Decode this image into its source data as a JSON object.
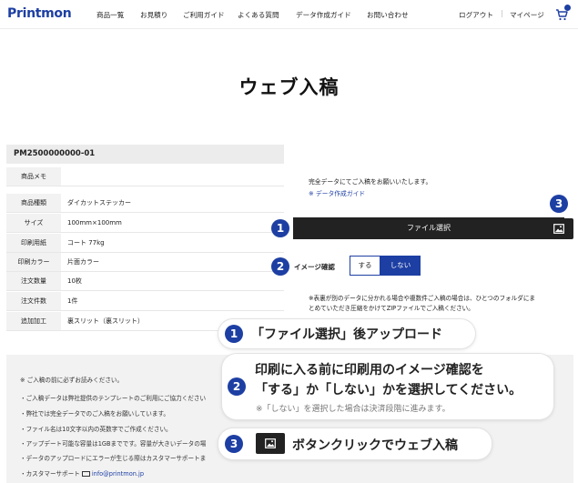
{
  "header": {
    "logo": "Printmon",
    "nav": [
      "商品一覧",
      "お見積り",
      "ご利用ガイド",
      "よくある質問",
      "データ作成ガイド",
      "お問い合わせ"
    ],
    "logout": "ログアウト",
    "separator": "|",
    "mypage": "マイページ",
    "cart_icon": "cart-icon"
  },
  "page": {
    "title": "ウェブ入稿"
  },
  "order": {
    "id": "PM2500000000-01",
    "rows": [
      {
        "label": "商品メモ",
        "value": ""
      },
      {
        "label": "商品種類",
        "value": "ダイカットステッカー"
      },
      {
        "label": "サイズ",
        "value": "100mm×100mm"
      },
      {
        "label": "印刷用紙",
        "value": "コート 77kg"
      },
      {
        "label": "印刷カラー",
        "value": "片面カラー"
      },
      {
        "label": "注文数量",
        "value": "10枚"
      },
      {
        "label": "注文件数",
        "value": "1件"
      },
      {
        "label": "追加加工",
        "value": "裏スリット（裏スリット）"
      }
    ]
  },
  "upload": {
    "intro": "完全データにてご入稿をお願いいたします。",
    "guide_link": "※ データ作成ガイド",
    "file_button": "ファイル選択",
    "image_button_icon": "image-icon",
    "image_confirm_label": "イメージ確認",
    "toggle_yes": "する",
    "toggle_no": "しない",
    "note_line1": "※表裏が別のデータに分かれる場合や複数件ご入稿の場合は、ひとつのフォルダにま",
    "note_line2": "とめていただき圧縮をかけてZIPファイルでご入稿ください。"
  },
  "lower_notes": {
    "heading": "※ ご入稿の前に必ずお読みください。",
    "items": [
      "・ご入稿データは弊社提供のテンプレートのご利用にご協力ください",
      "・弊社では完全データでのご入稿をお願いしています。",
      "・ファイル名は10文字以内の英数字でご作成ください。",
      "・アップデート可能な容量は1GBまでです。容量が大きいデータの場",
      "・データのアップロードにエラーが生じる際はカスタマーサポートま"
    ],
    "support_label": "・カスタマーサポート",
    "support_email": "info@printmon.jp"
  },
  "callouts": {
    "num1": "1",
    "num2": "2",
    "num3": "3",
    "step1_text": "「ファイル選択」後アップロード",
    "step2_line1": "印刷に入る前に印刷用のイメージ確認を",
    "step2_line2": "「する」か「しない」かを選択してください。",
    "step2_sub": "※「しない」を選択した場合は決済段階に進みます。",
    "step3_text": "ボタンクリックでウェブ入稿"
  },
  "colors": {
    "accent": "#1d3fa3",
    "dark": "#222222",
    "gray": "#f2f2f2"
  }
}
